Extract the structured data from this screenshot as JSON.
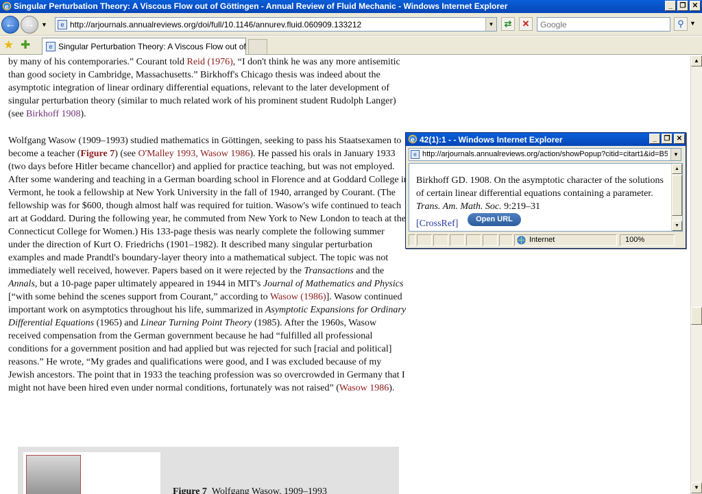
{
  "window": {
    "title": "Singular Perturbation Theory: A Viscous Flow out of Göttingen - Annual Review of Fluid Mechanic - Windows Internet Explorer",
    "minimize": "_",
    "maximize": "❐",
    "close": "✕"
  },
  "nav": {
    "back": "←",
    "forward": "→",
    "dropdown": "▼",
    "address": "http://arjournals.annualreviews.org/doi/full/10.1146/annurev.fluid.060909.133212",
    "address_icon": "e",
    "refresh": "⇄",
    "stop": "✕",
    "search_placeholder": "Google",
    "search_button": "⚲",
    "search_dropdown": "▼"
  },
  "tabs": {
    "favorites": "★",
    "add_favorite": "✚",
    "active_tab": "Singular Perturbation Theory: A Viscous Flow out of G...",
    "tab_icon": "e"
  },
  "article": {
    "p1": {
      "a": "by many of his contemporaries.” Courant told ",
      "reid": "Reid (1976)",
      "b": ", “I don't think he was any more antisemitic than good society in Cambridge, Massachusetts.” Birkhoff's Chicago thesis was indeed about the asymptotic integration of linear ordinary differential equations, relevant to the later development of singular perturbation theory (similar to much related work of his prominent student Rudolph Langer) (see ",
      "birkhoff": "Birkhoff 1908",
      "c": ")."
    },
    "p2": {
      "a": "Wolfgang Wasow (1909–1993) studied mathematics in Göttingen, seeking to pass his Staatsexamen to become a teacher (",
      "fig7": "Figure 7",
      "b": ") (see ",
      "omalley": "O'Malley 1993, Wasow 1986",
      "c": "). He passed his orals in January 1933 (two days before Hitler became chancellor) and applied for practice teaching, but was not employed. After some wandering and teaching in a German boarding school in Florence and at Goddard College in Vermont, he took a fellowship at New York University in the fall of 1940, arranged by Courant. (The fellowship was for $600, though almost half was required for tuition. Wasow's wife continued to teach art at Goddard. During the following year, he commuted from New York to New London to teach at the Connecticut College for Women.) His 133-page thesis was nearly complete the following summer under the direction of Kurt O. Friedrichs (1901–1982). It described many singular perturbation examples and made Prandtl's boundary-layer theory into a mathematical subject. The topic was not immediately well received, however. Papers based on it were rejected by the ",
      "transactions": "Transactions",
      "d": " and the ",
      "annals": "Annals",
      "e": ", but a 10-page paper ultimately appeared in 1944 in MIT's ",
      "journal": "Journal of Mathematics and Physics",
      "f": " [“with some behind the scenes support from Courant,” according to ",
      "wasow1986a": "Wasow (1986)",
      "g": "]. Wasow continued important work on asymptotics throughout his life, summarized in ",
      "book1": "Asymptotic Expansions for Ordinary Differential Equations",
      "h": " (1965) and ",
      "book2": "Linear Turning Point Theory",
      "i": " (1985). After the 1960s, Wasow received compensation from the German government because he had “fulfilled all professional conditions for a government position and had applied but was rejected for such [racial and political] reasons.” He wrote, “My grades and qualifications were good, and I was excluded because of my Jewish ancestors. The point that in 1933 the teaching profession was so overcrowded in Germany that I might not have been hired even under normal conditions, fortunately was not raised” (",
      "wasow1986b": "Wasow 1986",
      "j": ")."
    },
    "figure": {
      "caption_label": "Figure 7",
      "caption_text": "Wolfgang Wasow, 1909–1993"
    }
  },
  "popup": {
    "title": "42(1):1 - - Windows Internet Explorer",
    "address": "http://arjournals.annualreviews.org/action/showPopup?citid=citart1&id=B5",
    "ref_a": "Birkhoff GD. 1908. On the asymptotic character of the solutions of certain linear differential equations containing a parameter. ",
    "ref_journal": "Trans. Am. Math. Soc.",
    "ref_b": " 9:219–31",
    "crossref": "[CrossRef]",
    "open_url": "Open URL",
    "status_zone": "Internet",
    "status_zoom": "100%"
  },
  "scroll": {
    "up": "▲",
    "down": "▼"
  }
}
